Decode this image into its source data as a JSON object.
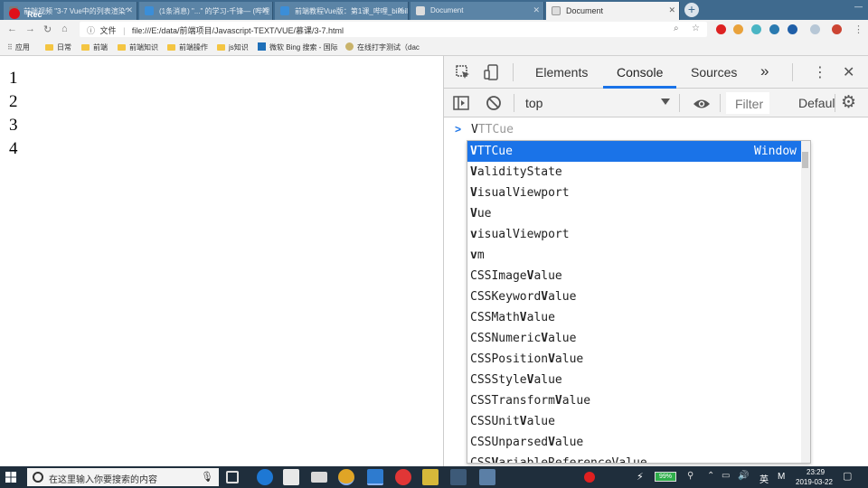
{
  "recorder": {
    "label": "Rec"
  },
  "tabs": [
    {
      "title": "前端视频 \"3-7 Vue中的列表渲染\"",
      "color": "#7a7a7a"
    },
    {
      "title": "(1条消息) \"...\" 的学习-千锋—  (哔哩",
      "color": "#3b8ed8"
    },
    {
      "title": "前端教程Vue版：第1课_哔哩_bilibili",
      "color": "#3b8ed8"
    },
    {
      "title": "Document",
      "color": "#dddddd"
    },
    {
      "title": "Document",
      "color": "#dddddd",
      "active": true
    }
  ],
  "toolbar": {
    "url_prefix": "文件",
    "url": "file:///E:/data/前端项目/Javascript-TEXT/VUE/慕课/3-7.html"
  },
  "bookmarks": [
    {
      "label": "应用",
      "type": "apps"
    },
    {
      "label": "日常",
      "type": "folder"
    },
    {
      "label": "前端",
      "type": "folder"
    },
    {
      "label": "前端知识",
      "type": "folder"
    },
    {
      "label": "前端操作",
      "type": "folder"
    },
    {
      "label": "js知识",
      "type": "folder"
    },
    {
      "label": "微软 Bing 搜索 - 国际",
      "type": "link"
    },
    {
      "label": "在线打字测试（dac",
      "type": "link"
    }
  ],
  "page": {
    "lines": [
      "1",
      "2",
      "3",
      "4"
    ]
  },
  "devtools": {
    "tabs": [
      "Elements",
      "Console",
      "Sources",
      "»"
    ],
    "active_tab": "Console",
    "context": "top",
    "filter_placeholder": "Filter",
    "levels": "Default levels",
    "prompt_typed": "V",
    "prompt_ghost": "TTCue",
    "suggestions": [
      {
        "label": "VTTCue",
        "hint": "Window",
        "selected": true
      },
      {
        "label": "ValidityState"
      },
      {
        "label": "VisualViewport"
      },
      {
        "label": "Vue"
      },
      {
        "label": "visualViewport"
      },
      {
        "label": "vm"
      },
      {
        "label": "CSSImageValue"
      },
      {
        "label": "CSSKeywordValue"
      },
      {
        "label": "CSSMathValue"
      },
      {
        "label": "CSSNumericValue"
      },
      {
        "label": "CSSPositionValue"
      },
      {
        "label": "CSSStyleValue"
      },
      {
        "label": "CSSTransformValue"
      },
      {
        "label": "CSSUnitValue"
      },
      {
        "label": "CSSUnparsedValue"
      },
      {
        "label": "CSSVariableReferenceValue"
      }
    ]
  },
  "taskbar": {
    "search_placeholder": "在这里输入你要搜索的内容",
    "battery": "99%",
    "lang": "英",
    "ime": "M",
    "time": "23:29",
    "date": "2019-03-22"
  },
  "colors": {
    "accent": "#1a73e8",
    "taskbar": "#1f2e3c",
    "tabstrip": "#3f6a8e"
  }
}
